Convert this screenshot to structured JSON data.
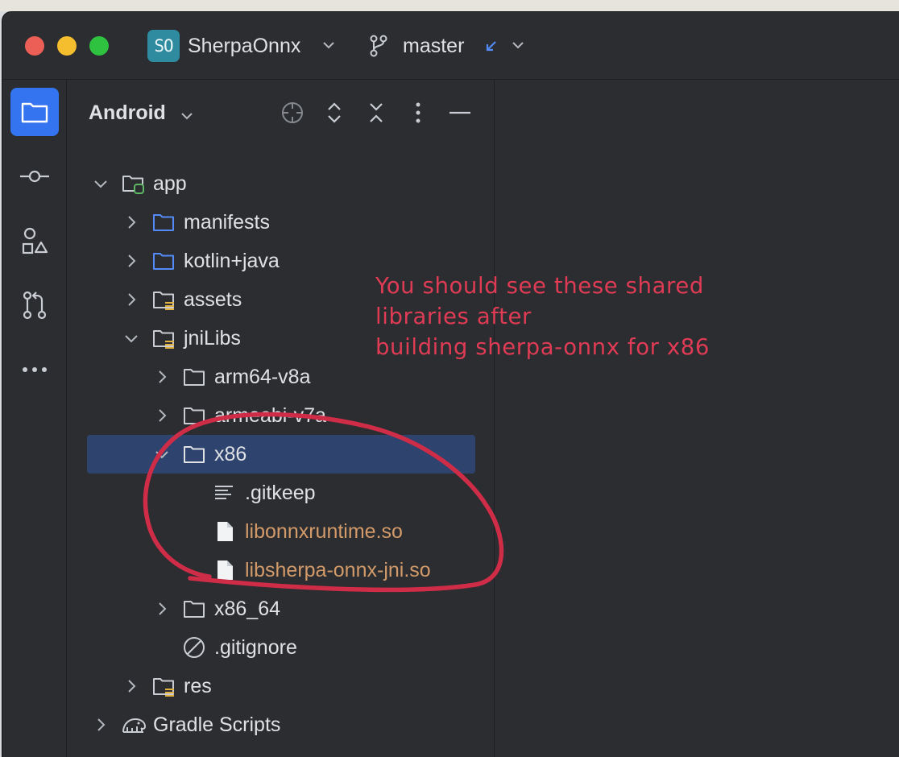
{
  "titlebar": {
    "project_badge": "SO",
    "project_name": "SherpaOnnx",
    "branch_name": "master"
  },
  "stripe": {
    "tools": [
      "folder-icon",
      "commit-icon",
      "structure-icon",
      "pull-request-icon",
      "more-icon"
    ]
  },
  "panel": {
    "title": "Android"
  },
  "tree": {
    "app": "app",
    "manifests": "manifests",
    "kotlin_java": "kotlin+java",
    "assets": "assets",
    "jnilibs": "jniLibs",
    "arm64": "arm64-v8a",
    "armeabi": "armeabi-v7a",
    "x86": "x86",
    "gitkeep": ".gitkeep",
    "libonnxruntime": "libonnxruntime.so",
    "libsherpa": "libsherpa-onnx-jni.so",
    "x86_64": "x86_64",
    "gitignore": ".gitignore",
    "res": "res",
    "gradle": "Gradle Scripts"
  },
  "annotation": {
    "line1": "You should see these shared",
    "line2": "libraries after",
    "line3": "building sherpa-onnx for x86"
  },
  "colors": {
    "accent": "#3574f0",
    "selection": "#2e436e",
    "so_file_text": "#d39a6a",
    "annotation": "#e03b55"
  }
}
